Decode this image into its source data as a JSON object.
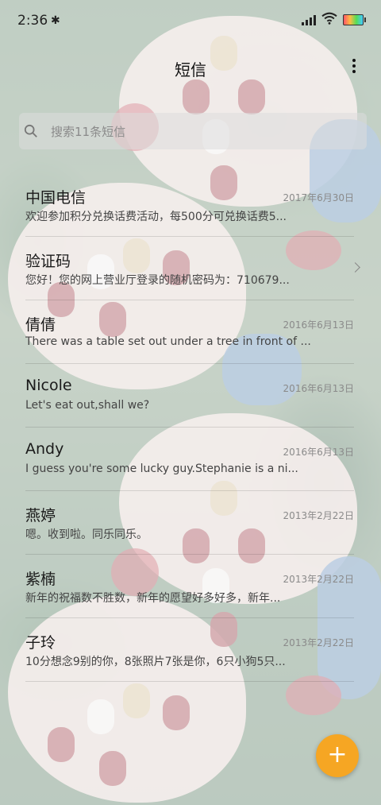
{
  "status": {
    "time": "2:36"
  },
  "header": {
    "title": "短信"
  },
  "search": {
    "placeholder": "搜索11条短信"
  },
  "messages": [
    {
      "name": "中国电信",
      "date": "2017年6月30日",
      "preview": "欢迎参加积分兑换话费活动，每500分可兑换话费5..."
    },
    {
      "name": "验证码",
      "date": "",
      "preview": "您好！您的网上营业厅登录的随机密码为：710679..."
    },
    {
      "name": "倩倩",
      "date": "2016年6月13日",
      "preview": "There was a table set out under a tree in front of ..."
    },
    {
      "name": "Nicole",
      "date": "2016年6月13日",
      "preview": "Let's eat out,shall we?"
    },
    {
      "name": "Andy",
      "date": "2016年6月13日",
      "preview": "I guess you're some lucky guy.Stephanie is a ni..."
    },
    {
      "name": "燕婷",
      "date": "2013年2月22日",
      "preview": "嗯。收到啦。同乐同乐。"
    },
    {
      "name": "紫楠",
      "date": "2013年2月22日",
      "preview": "新年的祝福数不胜数，新年的愿望好多好多，新年..."
    },
    {
      "name": "子玲",
      "date": "2013年2月22日",
      "preview": "10分想念9别的你，8张照片7张是你，6只小狗5只..."
    }
  ],
  "fab": {
    "label": "+"
  },
  "colors": {
    "accent": "#f6a623"
  }
}
